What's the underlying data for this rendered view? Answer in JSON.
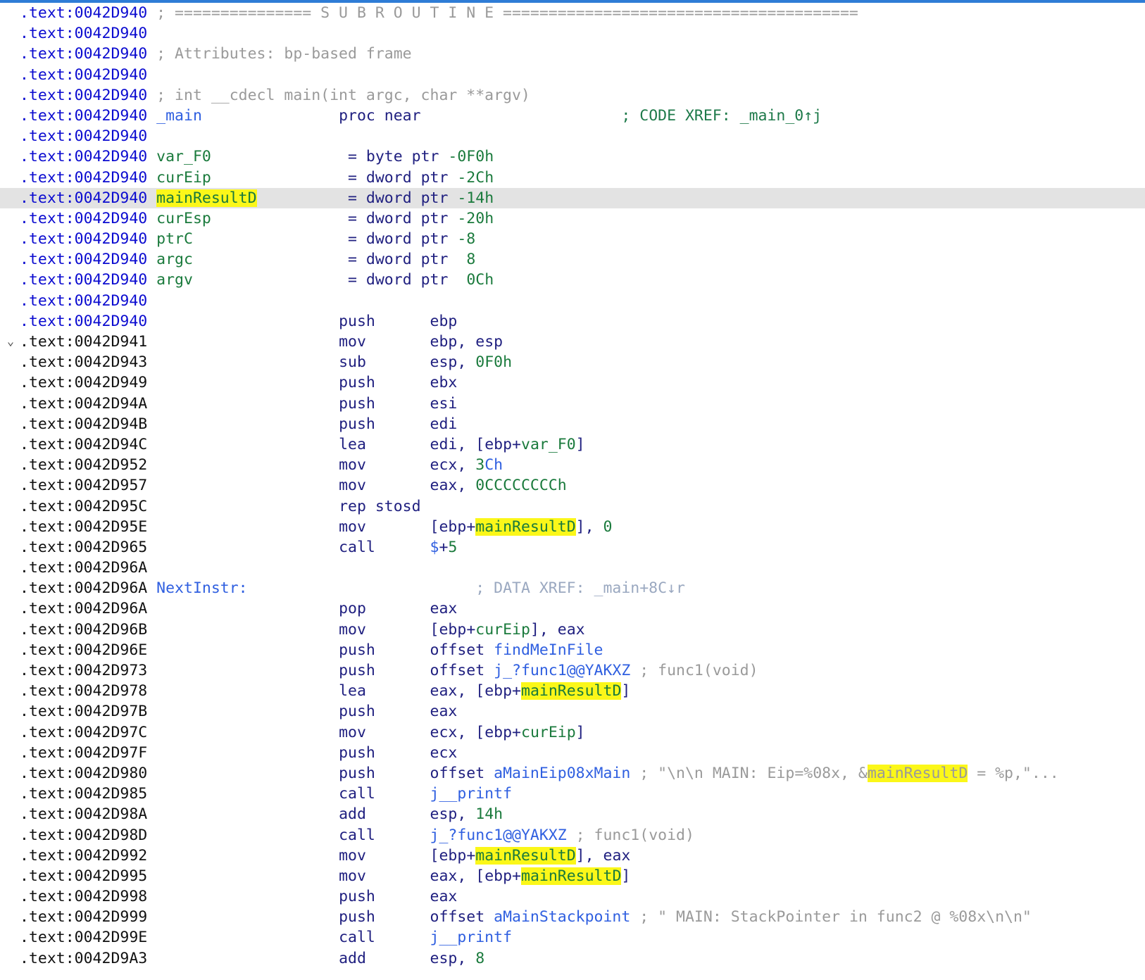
{
  "view": {
    "name": "IDA Pro IDA View-A disassembly listing",
    "segment": ".text",
    "function": "_main",
    "highlighted_identifier": "mainResultD",
    "cursor_line_index": 9,
    "colors": {
      "background": "#ffffff",
      "cursor_line": "#e3e3e3",
      "highlight": "#fbf719",
      "address": "#0b0bd0",
      "comment": "#9a9a9a",
      "xref_comment": "#1e7a4a",
      "name_green": "#1a7a3c",
      "mnemonic": "#202080",
      "symbol_blue": "#2f5fe0",
      "top_border": "#2e7cd6"
    },
    "gutter": {
      "collapse_icon_line_index": 16,
      "collapse_icon_glyph": "⌄"
    }
  },
  "lines": [
    {
      "addr": ".text:0042D940",
      "dim": false,
      "kind": "comment",
      "text": "; =============== S U B R O U T I N E ======================================="
    },
    {
      "addr": ".text:0042D940",
      "dim": false,
      "kind": "blank",
      "text": ""
    },
    {
      "addr": ".text:0042D940",
      "dim": false,
      "kind": "comment",
      "text": "; Attributes: bp-based frame"
    },
    {
      "addr": ".text:0042D940",
      "dim": false,
      "kind": "blank",
      "text": ""
    },
    {
      "addr": ".text:0042D940",
      "dim": false,
      "kind": "comment",
      "text": "; int __cdecl main(int argc, char **argv)"
    },
    {
      "addr": ".text:0042D940",
      "dim": false,
      "kind": "proc",
      "label": "_main",
      "mnem": "proc near",
      "xref": "; CODE XREF: _main_0↑j"
    },
    {
      "addr": ".text:0042D940",
      "dim": false,
      "kind": "blank",
      "text": ""
    },
    {
      "addr": ".text:0042D940",
      "dim": false,
      "kind": "vardecl",
      "var": "var_F0",
      "def": "= byte ptr -0F0h",
      "hl": false
    },
    {
      "addr": ".text:0042D940",
      "dim": false,
      "kind": "vardecl",
      "var": "curEip",
      "def": "= dword ptr -2Ch",
      "hl": false
    },
    {
      "addr": ".text:0042D940",
      "dim": false,
      "kind": "vardecl",
      "var": "mainResultD",
      "def": "= dword ptr -14h",
      "hl": true
    },
    {
      "addr": ".text:0042D940",
      "dim": false,
      "kind": "vardecl",
      "var": "curEsp",
      "def": "= dword ptr -20h",
      "hl": false
    },
    {
      "addr": ".text:0042D940",
      "dim": false,
      "kind": "vardecl",
      "var": "ptrC",
      "def": "= dword ptr -8",
      "hl": false
    },
    {
      "addr": ".text:0042D940",
      "dim": false,
      "kind": "vardecl",
      "var": "argc",
      "def": "= dword ptr  8",
      "hl": false
    },
    {
      "addr": ".text:0042D940",
      "dim": false,
      "kind": "vardecl",
      "var": "argv",
      "def": "= dword ptr  0Ch",
      "hl": false
    },
    {
      "addr": ".text:0042D940",
      "dim": false,
      "kind": "blank",
      "text": ""
    },
    {
      "addr": ".text:0042D940",
      "dim": false,
      "kind": "insn",
      "mnem": "push",
      "ops": "ebp"
    },
    {
      "addr": ".text:0042D941",
      "dim": true,
      "kind": "insn",
      "mnem": "mov",
      "ops": "ebp, esp"
    },
    {
      "addr": ".text:0042D943",
      "dim": true,
      "kind": "insn",
      "mnem": "sub",
      "ops": "esp, 0F0h"
    },
    {
      "addr": ".text:0042D949",
      "dim": true,
      "kind": "insn",
      "mnem": "push",
      "ops": "ebx"
    },
    {
      "addr": ".text:0042D94A",
      "dim": true,
      "kind": "insn",
      "mnem": "push",
      "ops": "esi"
    },
    {
      "addr": ".text:0042D94B",
      "dim": true,
      "kind": "insn",
      "mnem": "push",
      "ops": "edi"
    },
    {
      "addr": ".text:0042D94C",
      "dim": true,
      "kind": "insn",
      "mnem": "lea",
      "ops": "edi, [ebp+var_F0]"
    },
    {
      "addr": ".text:0042D952",
      "dim": true,
      "kind": "insn",
      "mnem": "mov",
      "ops": "ecx, 3Ch"
    },
    {
      "addr": ".text:0042D957",
      "dim": true,
      "kind": "insn",
      "mnem": "mov",
      "ops": "eax, 0CCCCCCCCh"
    },
    {
      "addr": ".text:0042D95C",
      "dim": true,
      "kind": "insn",
      "mnem": "rep stosd",
      "ops": ""
    },
    {
      "addr": ".text:0042D95E",
      "dim": true,
      "kind": "insn",
      "mnem": "mov",
      "ops": "[ebp+mainResultD], 0"
    },
    {
      "addr": ".text:0042D965",
      "dim": true,
      "kind": "insn",
      "mnem": "call",
      "ops": "$+5"
    },
    {
      "addr": ".text:0042D96A",
      "dim": true,
      "kind": "blank",
      "text": ""
    },
    {
      "addr": ".text:0042D96A",
      "dim": true,
      "kind": "codelabel",
      "label": "NextInstr:",
      "xref": "; DATA XREF: _main+8C↓r"
    },
    {
      "addr": ".text:0042D96A",
      "dim": true,
      "kind": "insn",
      "mnem": "pop",
      "ops": "eax"
    },
    {
      "addr": ".text:0042D96B",
      "dim": true,
      "kind": "insn",
      "mnem": "mov",
      "ops": "[ebp+curEip], eax"
    },
    {
      "addr": ".text:0042D96E",
      "dim": true,
      "kind": "insn",
      "mnem": "push",
      "ops": "offset findMeInFile"
    },
    {
      "addr": ".text:0042D973",
      "dim": true,
      "kind": "insn",
      "mnem": "push",
      "ops": "offset j_?func1@@YAKXZ",
      "cmt": "; func1(void)"
    },
    {
      "addr": ".text:0042D978",
      "dim": true,
      "kind": "insn",
      "mnem": "lea",
      "ops": "eax, [ebp+mainResultD]"
    },
    {
      "addr": ".text:0042D97B",
      "dim": true,
      "kind": "insn",
      "mnem": "push",
      "ops": "eax"
    },
    {
      "addr": ".text:0042D97C",
      "dim": true,
      "kind": "insn",
      "mnem": "mov",
      "ops": "ecx, [ebp+curEip]"
    },
    {
      "addr": ".text:0042D97F",
      "dim": true,
      "kind": "insn",
      "mnem": "push",
      "ops": "ecx"
    },
    {
      "addr": ".text:0042D980",
      "dim": true,
      "kind": "insn",
      "mnem": "push",
      "ops": "offset aMainEip08xMain",
      "cmt": "; \"\\n\\n MAIN: Eip=%08x, &mainResultD = %p,\"..."
    },
    {
      "addr": ".text:0042D985",
      "dim": true,
      "kind": "insn",
      "mnem": "call",
      "ops": "j__printf"
    },
    {
      "addr": ".text:0042D98A",
      "dim": true,
      "kind": "insn",
      "mnem": "add",
      "ops": "esp, 14h"
    },
    {
      "addr": ".text:0042D98D",
      "dim": true,
      "kind": "insn",
      "mnem": "call",
      "ops": "j_?func1@@YAKXZ",
      "cmt": "; func1(void)"
    },
    {
      "addr": ".text:0042D992",
      "dim": true,
      "kind": "insn",
      "mnem": "mov",
      "ops": "[ebp+mainResultD], eax"
    },
    {
      "addr": ".text:0042D995",
      "dim": true,
      "kind": "insn",
      "mnem": "mov",
      "ops": "eax, [ebp+mainResultD]"
    },
    {
      "addr": ".text:0042D998",
      "dim": true,
      "kind": "insn",
      "mnem": "push",
      "ops": "eax"
    },
    {
      "addr": ".text:0042D999",
      "dim": true,
      "kind": "insn",
      "mnem": "push",
      "ops": "offset aMainStackpoint",
      "cmt": "; \" MAIN: StackPointer in func2 @ %08x\\n\\n\""
    },
    {
      "addr": ".text:0042D99E",
      "dim": true,
      "kind": "insn",
      "mnem": "call",
      "ops": "j__printf"
    },
    {
      "addr": ".text:0042D9A3",
      "dim": true,
      "kind": "insn",
      "mnem": "add",
      "ops": "esp, 8"
    }
  ]
}
